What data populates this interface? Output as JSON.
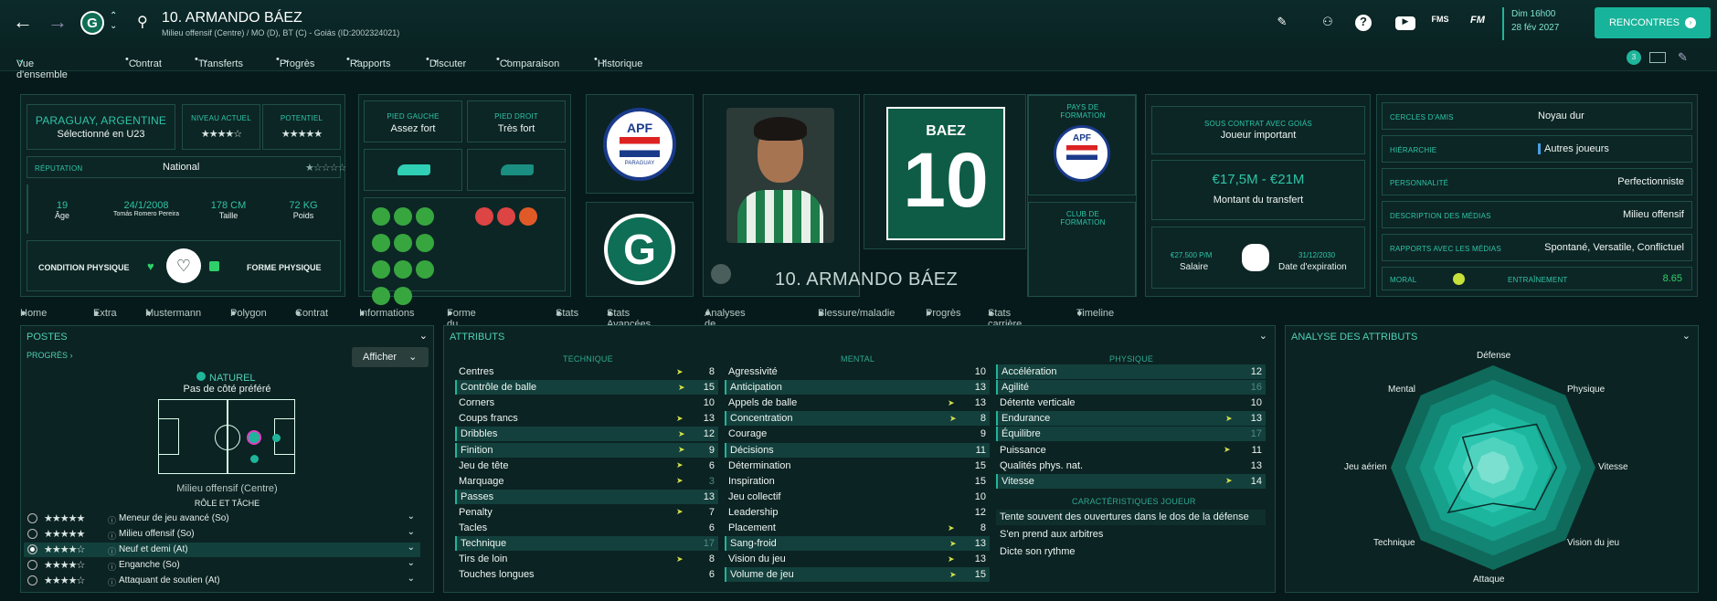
{
  "header": {
    "player_name": "10. ARMANDO BÁEZ",
    "player_sub": "Milieu offensif (Centre) / MO (D), BT (C) - Goiás (ID:2002324021)",
    "club_logo": "G",
    "date_line1": "Dim 16h00",
    "date_line2": "28 fév 2027",
    "rencontres": "RENCONTRES",
    "fms": "FMS",
    "fm": "FM",
    "notif_count": "3"
  },
  "subnav": [
    "Vue d'ensemble",
    "Contrat",
    "Transferts",
    "Progrès",
    "Rapports",
    "Discuter",
    "Comparaison",
    "Historique"
  ],
  "nationality": {
    "country": "PARAGUAY, ARGENTINE",
    "status": "Sélectionné en U23",
    "niveau_label": "NIVEAU ACTUEL",
    "potentiel_label": "POTENTIEL",
    "reputation_label": "RÉPUTATION",
    "reputation": "National"
  },
  "bio": {
    "age": "19",
    "age_label": "Âge",
    "dob": "24/1/2008",
    "birthplace": "Tomás Romero Pereira",
    "height": "178 CM",
    "height_label": "Taille",
    "weight": "72 KG",
    "weight_label": "Poids",
    "condition": "CONDITION PHYSIQUE",
    "forme": "FORME PHYSIQUE"
  },
  "feet": {
    "left_label": "PIED GAUCHE",
    "left": "Assez fort",
    "right_label": "PIED DROIT",
    "right": "Très fort"
  },
  "shirt": {
    "name": "BAEZ",
    "number": "10"
  },
  "formation": {
    "pays_label": "PAYS DE FORMATION",
    "club_label": "CLUB DE FORMATION",
    "apf": "APF",
    "paraguay": "PARAGUAY"
  },
  "contract": {
    "label": "SOUS CONTRAT AVEC GOIÁS",
    "role": "Joueur important",
    "value": "€17,5M - €21M",
    "value_label": "Montant du transfert",
    "salary": "€27.500 P/M",
    "salary_label": "Salaire",
    "expiry": "31/12/2030",
    "expiry_label": "Date d'expiration"
  },
  "personality": [
    {
      "k": "CERCLES D'AMIS",
      "v": "Noyau dur"
    },
    {
      "k": "HIÉRARCHIE",
      "v": "Autres joueurs"
    },
    {
      "k": "PERSONNALITÉ",
      "v": "Perfectionniste"
    },
    {
      "k": "DESCRIPTION DES MÉDIAS",
      "v": "Milieu offensif"
    },
    {
      "k": "RAPPORTS AVEC LES MÉDIAS",
      "v": "Spontané, Versatile, Conflictuel"
    }
  ],
  "morale": {
    "label": "MORAL",
    "training_label": "ENTRAÎNEMENT",
    "training": "8.65"
  },
  "tabs": [
    "Home",
    "Extra",
    "Mustermann",
    "Polygon",
    "Contrat",
    "Informations",
    "Forme du Joueur",
    "Stats",
    "Stats Avancées",
    "Analyses de joueur",
    "Blessure/maladie",
    "Progrès",
    "Stats carrière",
    "Timeline"
  ],
  "positions": {
    "title": "POSTES",
    "progres": "PROGRÈS",
    "afficher": "Afficher",
    "natural": "NATUREL",
    "foot_pref": "Pas de côté préféré",
    "position": "Milieu offensif (Centre)",
    "role_title": "RÔLE ET TÂCHE",
    "roles": [
      "Meneur de jeu avancé (So)",
      "Milieu offensif (So)",
      "Neuf et demi (At)",
      "Enganche (So)",
      "Attaquant de soutien (At)"
    ]
  },
  "attributes": {
    "title": "ATTRIBUTS",
    "technique_label": "TECHNIQUE",
    "mental_label": "MENTAL",
    "physique_label": "PHYSIQUE",
    "traits_label": "CARACTÉRISTIQUES JOUEUR",
    "technique": [
      [
        "Centres",
        "8"
      ],
      [
        "Contrôle de balle",
        "15"
      ],
      [
        "Corners",
        "10"
      ],
      [
        "Coups francs",
        "13"
      ],
      [
        "Dribbles",
        "12"
      ],
      [
        "Finition",
        "9"
      ],
      [
        "Jeu de tête",
        "6"
      ],
      [
        "Marquage",
        "3"
      ],
      [
        "Passes",
        "13"
      ],
      [
        "Penalty",
        "7"
      ],
      [
        "Tacles",
        "6"
      ],
      [
        "Technique",
        "17"
      ],
      [
        "Tirs de loin",
        "8"
      ],
      [
        "Touches longues",
        "6"
      ]
    ],
    "mental": [
      [
        "Agressivité",
        "10"
      ],
      [
        "Anticipation",
        "13"
      ],
      [
        "Appels de balle",
        "13"
      ],
      [
        "Concentration",
        "8"
      ],
      [
        "Courage",
        "9"
      ],
      [
        "Décisions",
        "11"
      ],
      [
        "Détermination",
        "15"
      ],
      [
        "Inspiration",
        "15"
      ],
      [
        "Jeu collectif",
        "10"
      ],
      [
        "Leadership",
        "12"
      ],
      [
        "Placement",
        "8"
      ],
      [
        "Sang-froid",
        "13"
      ],
      [
        "Vision du jeu",
        "13"
      ],
      [
        "Volume de jeu",
        "15"
      ]
    ],
    "physique": [
      [
        "Accélération",
        "12"
      ],
      [
        "Agilité",
        "16"
      ],
      [
        "Détente verticale",
        "10"
      ],
      [
        "Endurance",
        "13"
      ],
      [
        "Équilibre",
        "17"
      ],
      [
        "Puissance",
        "11"
      ],
      [
        "Qualités phys. nat.",
        "13"
      ],
      [
        "Vitesse",
        "14"
      ]
    ],
    "traits": [
      "Tente souvent des ouvertures dans le dos de la défense",
      "S'en prend aux arbitres",
      "Dicte son rythme"
    ]
  },
  "radar": {
    "title": "ANALYSE DES ATTRIBUTS",
    "labels": [
      "Défense",
      "Physique",
      "Vitesse",
      "Vision du jeu",
      "Attaque",
      "Technique",
      "Jeu aérien",
      "Mental"
    ]
  },
  "colors": {
    "accent": "#1fb59a",
    "bg": "#071a1b",
    "panel": "#0b2322"
  }
}
